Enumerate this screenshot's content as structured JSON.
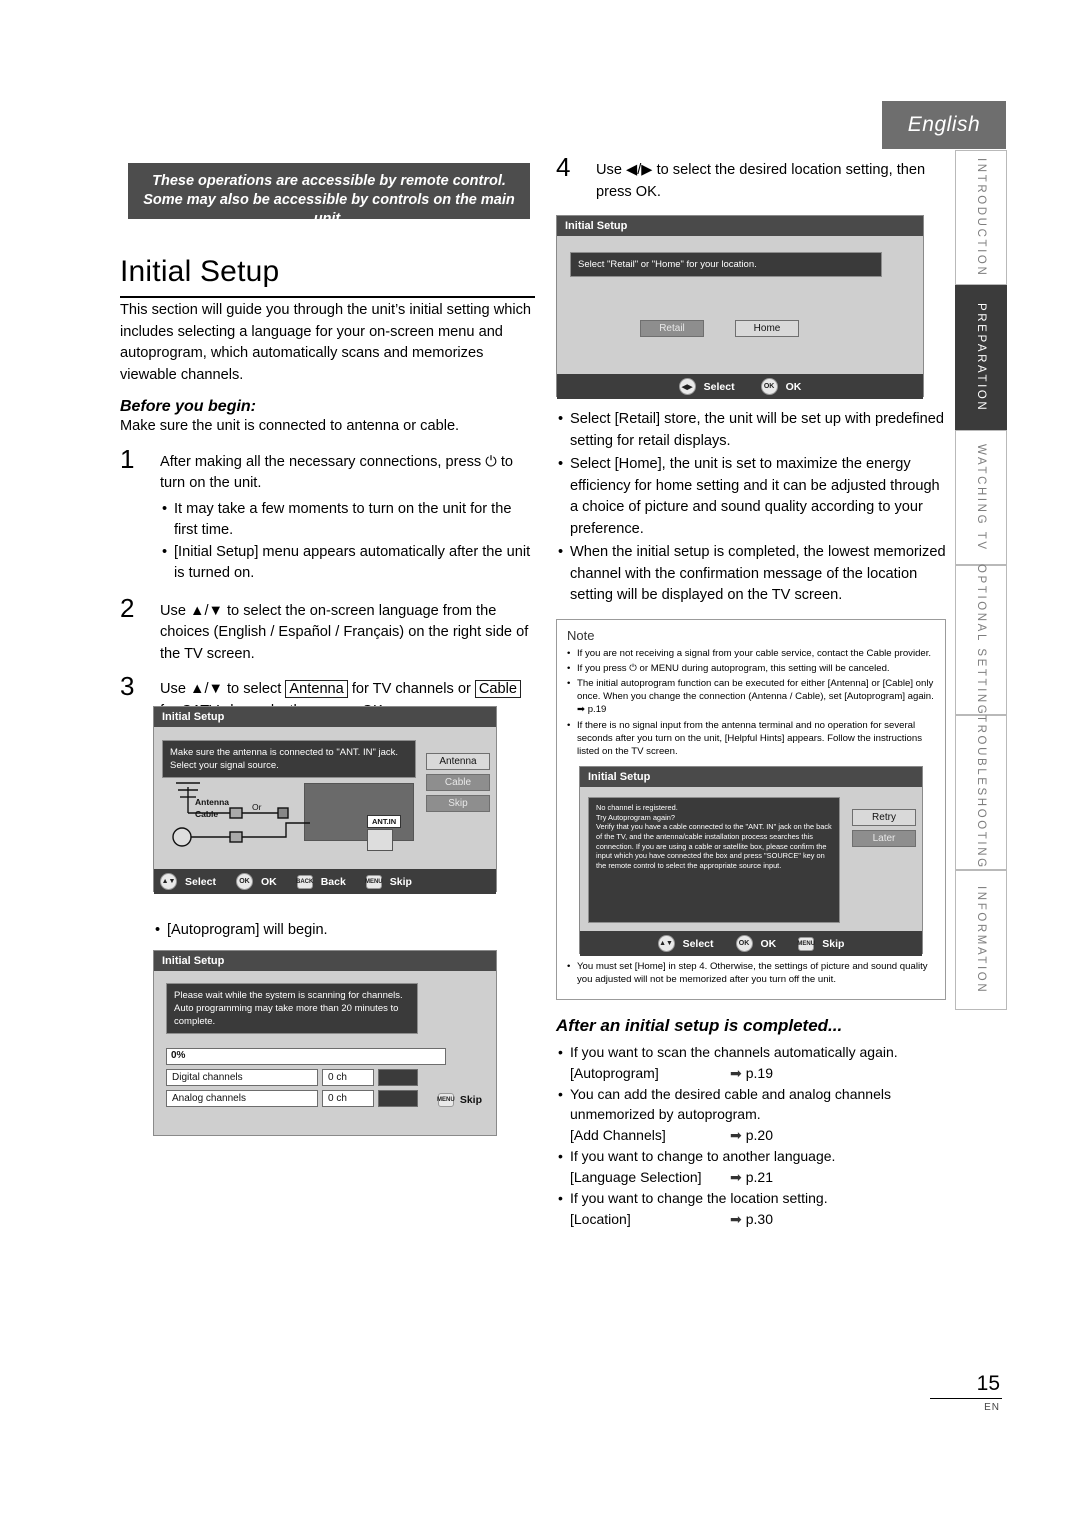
{
  "header": {
    "language_tab": "English"
  },
  "side_tabs": [
    {
      "label": "INTRODUCTION",
      "active": false
    },
    {
      "label": "PREPARATION",
      "active": true
    },
    {
      "label": "WATCHING TV",
      "active": false
    },
    {
      "label": "OPTIONAL SETTING",
      "active": false
    },
    {
      "label": "TROUBLESHOOTING",
      "active": false
    },
    {
      "label": "INFORMATION",
      "active": false
    }
  ],
  "banner": {
    "line1": "These operations are accessible by remote control.",
    "line2": "Some may also be accessible by controls on the main unit."
  },
  "left": {
    "title": "Initial Setup",
    "intro": "This section will guide you through the unit’s initial setting which includes selecting a language for your on-screen menu and autoprogram, which automatically scans and memorizes viewable channels.",
    "before_title": "Before you begin:",
    "before_text": "Make sure the unit is connected to antenna or cable.",
    "step1": {
      "num": "1",
      "text": "After making all the necessary connections, press ⏻ to turn on the unit.",
      "bullets": [
        "It may take a few moments to turn on the unit for the first time.",
        "[Initial Setup] menu appears automatically after the unit is turned on."
      ]
    },
    "step2": {
      "num": "2",
      "text": "Use ▲/▼ to select the on-screen language from the choices (English / Español / Français) on the right side of the TV screen."
    },
    "step3": {
      "num": "3",
      "text_a": "Use ▲/▼ to select ",
      "brk_antenna": "Antenna",
      "text_b": " for TV channels or ",
      "brk_cable": "Cable",
      "text_c": " for CATV channels, then press OK."
    },
    "osd_signal": {
      "title": "Initial Setup",
      "message_line1": "Make sure the antenna is connected to \"ANT. IN\" jack.",
      "message_line2": "Select your signal source.",
      "options": [
        "Antenna",
        "Cable",
        "Skip"
      ],
      "diagram_antenna": "Antenna",
      "diagram_cable": "Cable",
      "diagram_or": "Or",
      "diagram_antin": "ANT.IN",
      "bar": [
        {
          "key": "SELECT",
          "label": "Select"
        },
        {
          "key": "OK",
          "label": "OK"
        },
        {
          "key": "BACK",
          "label": "Back"
        },
        {
          "key": "MENU",
          "label": "Skip"
        }
      ]
    },
    "autoprogram_note": "[Autoprogram] will begin.",
    "osd_progress": {
      "title": "Initial Setup",
      "message": "Please wait while the system is scanning for channels. Auto programming may take more than 20 minutes to complete.",
      "percent": "0%",
      "rows": [
        {
          "name": "Digital channels",
          "value": "0 ch"
        },
        {
          "name": "Analog channels",
          "value": "0 ch"
        }
      ],
      "bar": [
        {
          "key": "MENU",
          "label": "Skip"
        }
      ]
    }
  },
  "right": {
    "step4": {
      "num": "4",
      "text": "Use ◀/▶ to select the desired location setting, then press OK."
    },
    "osd_location": {
      "title": "Initial Setup",
      "message": "Select \"Retail\" or \"Home\" for your location.",
      "buttons": [
        "Retail",
        "Home"
      ],
      "bar": [
        {
          "key": "SELECT",
          "label": "Select"
        },
        {
          "key": "OK",
          "label": "OK"
        }
      ]
    },
    "bullets": [
      "Select [Retail] store, the unit will be set up with predefined setting for retail displays.",
      "Select [Home], the unit is set to maximize the energy efficiency for home setting and it can be adjusted through a choice of picture and sound quality according to your preference.",
      "When the initial setup is completed, the lowest memorized channel with the confirmation message of the location setting will be displayed on the TV screen."
    ],
    "note": {
      "title": "Note",
      "items": [
        "If you are not receiving a signal from your cable service, contact the Cable provider.",
        "If you press ⏻ or MENU during autoprogram, this setting will be canceled.",
        "The initial autoprogram function can be executed for either [Antenna] or [Cable] only once. When you change the connection (Antenna / Cable), set [Autoprogram] again. ➡ p.19",
        "If there is no signal input from the antenna terminal and no operation for several seconds after you turn on the unit, [Helpful Hints] appears. Follow the instructions listed on the TV screen."
      ],
      "osd_retry": {
        "title": "Initial Setup",
        "message": "No channel is registered.\nTry Autoprogram again?\nVerify that you have a cable connected to the \"ANT. IN\" jack on the back of the TV, and the antenna/cable installation process searches this connection. If you are using a cable or satellite box, please confirm the input which you have connected the box and press \"SOURCE\" key on the remote control to select the appropriate source input.",
        "buttons": [
          "Retry",
          "Later"
        ],
        "bar": [
          {
            "key": "SELECT",
            "label": "Select"
          },
          {
            "key": "OK",
            "label": "OK"
          },
          {
            "key": "MENU",
            "label": "Skip"
          }
        ]
      },
      "last_item": "You must set [Home] in step 4. Otherwise, the settings of picture and sound quality you adjusted will not be memorized after you turn off the unit."
    },
    "after_title": "After an initial setup is completed...",
    "after_items": [
      {
        "text": "If you want to scan the channels automatically again.",
        "ref": "[Autoprogram]",
        "page": "p.19"
      },
      {
        "text": "You can add the desired cable and analog channels unmemorized by autoprogram.",
        "ref": "[Add Channels]",
        "page": "p.20"
      },
      {
        "text": "If you want to change to another language.",
        "ref": "[Language Selection]",
        "page": "p.21"
      },
      {
        "text": "If you want to change the location setting.",
        "ref": "[Location]",
        "page": "p.30"
      }
    ]
  },
  "footer": {
    "page_number": "15",
    "page_lang": "EN"
  }
}
